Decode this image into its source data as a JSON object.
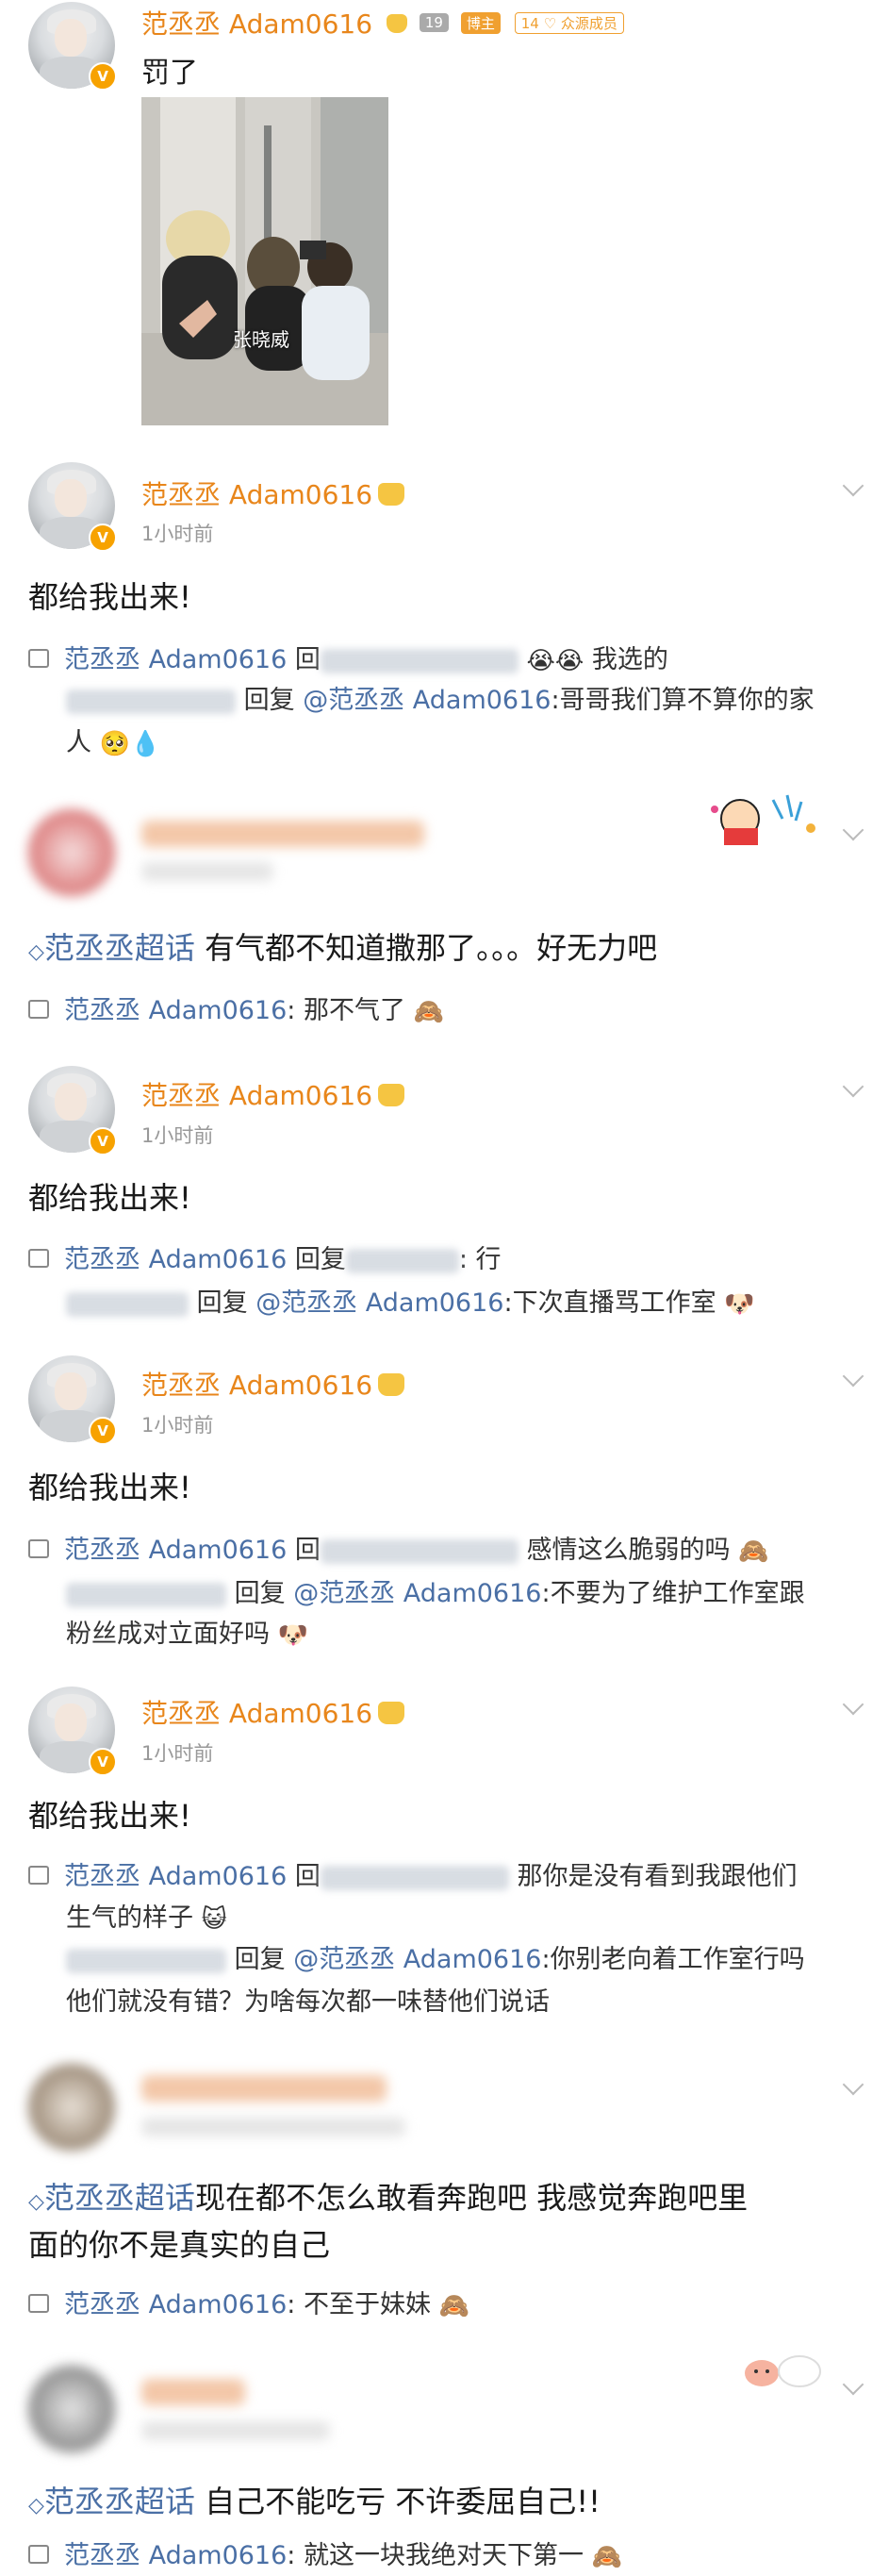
{
  "top_post": {
    "username": "范丞丞 Adam0616",
    "tag_level": "19",
    "tag_blogger": "博主",
    "tag_fan": "14 ♡ 众源成员",
    "text": "罚了",
    "photo_label": "张晓威"
  },
  "posts": [
    {
      "username": "范丞丞 Adam0616",
      "time": "1小时前",
      "content": "都给我出来!",
      "reply_from": "范丞丞 Adam0616",
      "reply_hui": "回",
      "reply_text": "我选的",
      "reply_line2_prefix": "回复",
      "reply_at": "@范丞丞 Adam0616",
      "reply_line2_text": ":哥哥我们算不算你的家",
      "reply_line3": "人"
    },
    {
      "super_topic": "范丞丞超话",
      "content": "有气都不知道撒那了。。。好无力吧",
      "reply_from": "范丞丞 Adam0616",
      "reply_text": ": 那不气了"
    },
    {
      "username": "范丞丞 Adam0616",
      "time": "1小时前",
      "content": "都给我出来!",
      "reply_from": "范丞丞 Adam0616",
      "reply_hui": "回复",
      "reply_text": ": 行",
      "reply_line2_prefix": "回复",
      "reply_at": "@范丞丞 Adam0616",
      "reply_line2_text": ":下次直播骂工作室"
    },
    {
      "username": "范丞丞 Adam0616",
      "time": "1小时前",
      "content": "都给我出来!",
      "reply_from": "范丞丞 Adam0616",
      "reply_hui": "回",
      "reply_text": "感情这么脆弱的吗",
      "reply_line2_prefix": "回复",
      "reply_at": "@范丞丞 Adam0616",
      "reply_line2_text": ":不要为了维护工作室跟",
      "reply_line3": "粉丝成对立面好吗"
    },
    {
      "username": "范丞丞 Adam0616",
      "time": "1小时前",
      "content": "都给我出来!",
      "reply_from": "范丞丞 Adam0616",
      "reply_hui": "回",
      "reply_text": "那你是没有看到我跟他们",
      "reply_line2": "生气的样子",
      "reply_line3_prefix": "回复",
      "reply_at": "@范丞丞 Adam0616",
      "reply_line3_text": ":你别老向着工作室行吗",
      "reply_line4": "他们就没有错？为啥每次都一味替他们说话"
    },
    {
      "super_topic": "范丞丞超话",
      "content": "现在都不怎么敢看奔跑吧 我感觉奔跑吧里",
      "content_line2": "面的你不是真实的自己",
      "reply_from": "范丞丞 Adam0616",
      "reply_text": ": 不至于妹妹"
    },
    {
      "super_topic": "范丞丞超话",
      "content": "自己不能吃亏 不许委屈自己!!",
      "reply_from": "范丞丞 Adam0616",
      "reply_text": ": 就这一块我绝对天下第一"
    }
  ],
  "icons": {
    "verified": "V",
    "monkey": "🙈",
    "pleading": "🥺",
    "droplet": "💧",
    "dog": "🐶",
    "smile": "😺",
    "crying": "😭"
  }
}
